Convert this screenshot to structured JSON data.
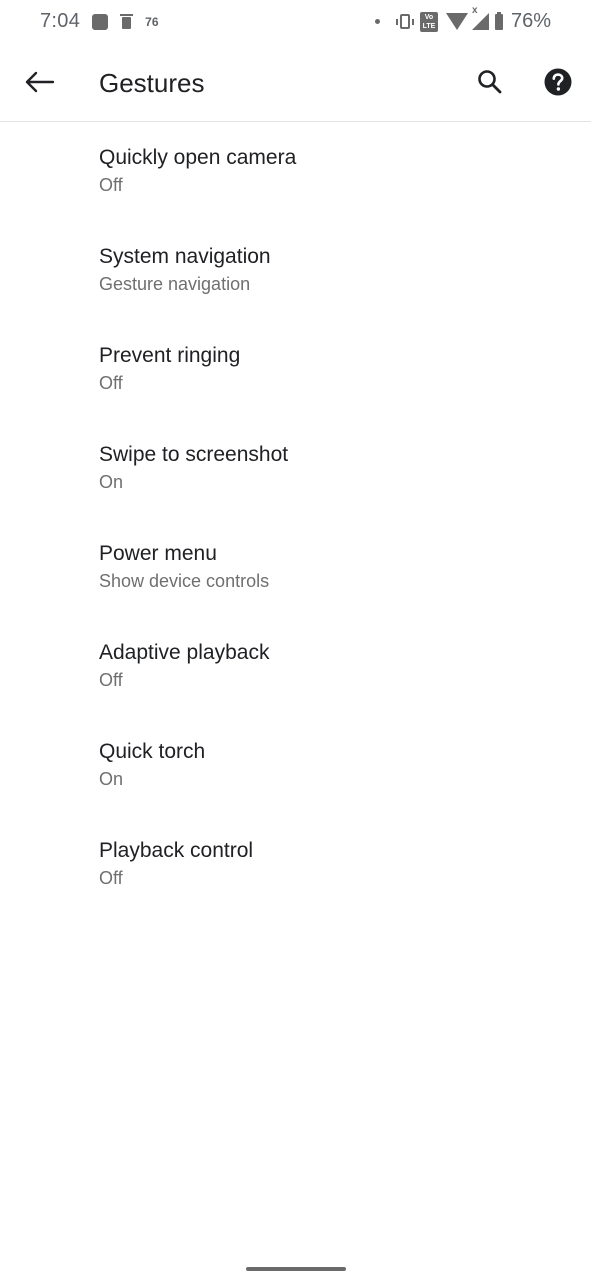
{
  "status_bar": {
    "time": "7:04",
    "notification_count": "76",
    "volte": [
      "Vo",
      "LTE"
    ],
    "signal_badge": "x",
    "battery": "76%",
    "icons": [
      "photo-icon",
      "trash-icon",
      "dot-icon",
      "vibrate-icon",
      "volte-icon",
      "wifi-icon",
      "signal-icon",
      "battery-icon"
    ]
  },
  "app_bar": {
    "title": "Gestures",
    "icons": [
      "back-arrow-icon",
      "search-icon",
      "help-icon"
    ]
  },
  "settings": [
    {
      "title": "Quickly open camera",
      "summary": "Off"
    },
    {
      "title": "System navigation",
      "summary": "Gesture navigation"
    },
    {
      "title": "Prevent ringing",
      "summary": "Off"
    },
    {
      "title": "Swipe to screenshot",
      "summary": "On"
    },
    {
      "title": "Power menu",
      "summary": "Show device controls"
    },
    {
      "title": "Adaptive playback",
      "summary": "Off"
    },
    {
      "title": "Quick torch",
      "summary": "On"
    },
    {
      "title": "Playback control",
      "summary": "Off"
    }
  ]
}
